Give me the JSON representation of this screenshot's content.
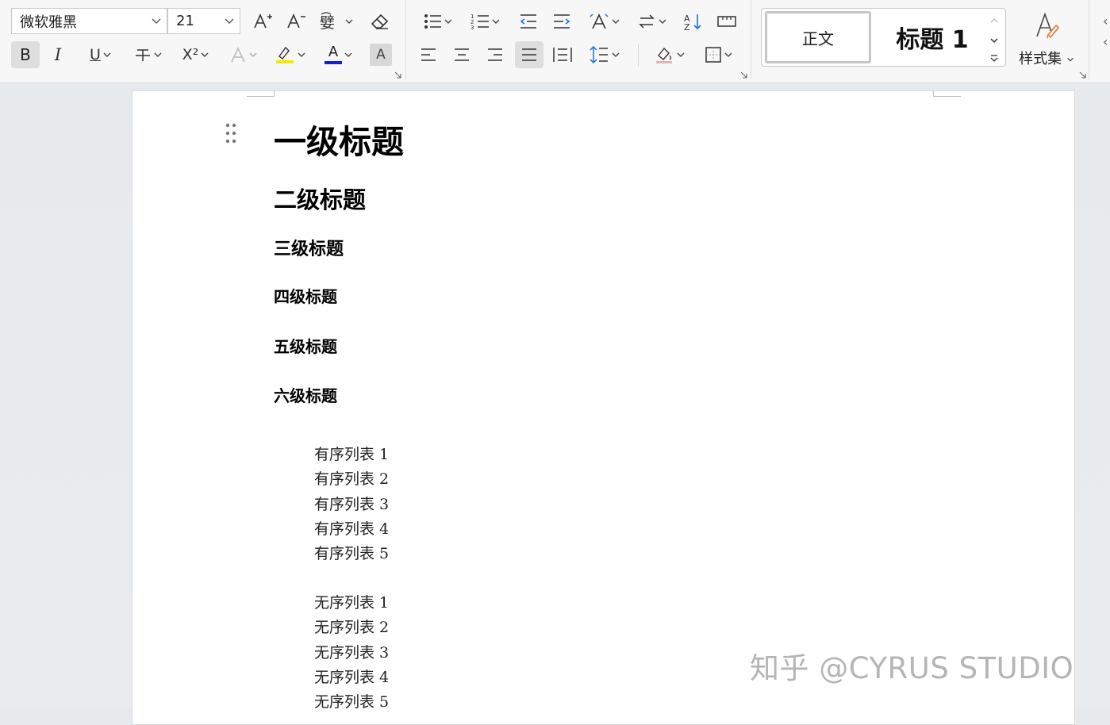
{
  "toolbar": {
    "font_name": "微软雅黑",
    "font_size": "21",
    "bold_label": "B",
    "italic_label": "I",
    "underline_label": "U",
    "superscript_label": "X²",
    "font_color_label": "A",
    "highlight_color": "#f5e800",
    "font_color": "#1420c8",
    "char_shading_label": "A"
  },
  "styles": {
    "normal_label": "正文",
    "heading1_label": "标题 1",
    "style_set_label": "样式集"
  },
  "document": {
    "h1": "一级标题",
    "h2": "二级标题",
    "h3": "三级标题",
    "h4": "四级标题",
    "h5": "五级标题",
    "h6": "六级标题",
    "ordered_list": [
      "有序列表 1",
      "有序列表 2",
      "有序列表 3",
      "有序列表 4",
      "有序列表 5"
    ],
    "unordered_list": [
      "无序列表 1",
      "无序列表 2",
      "无序列表 3",
      "无序列表 4",
      "无序列表 5"
    ]
  },
  "watermark": "知乎 @CYRUS STUDIO"
}
